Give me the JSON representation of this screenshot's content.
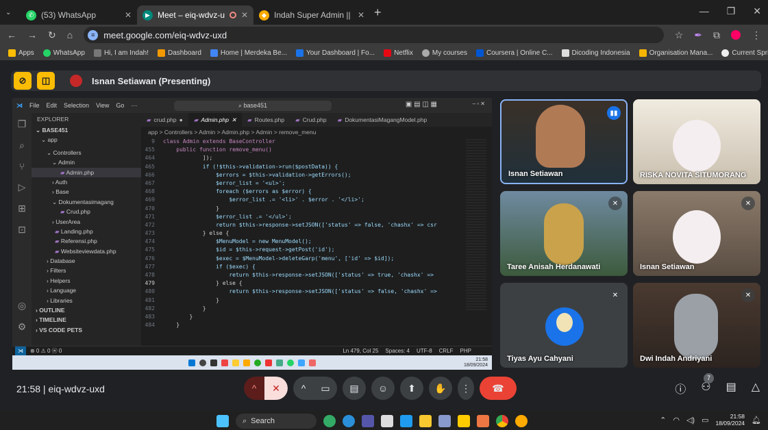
{
  "browser": {
    "tabs": [
      {
        "title": "(53) WhatsApp"
      },
      {
        "title": "Meet – eiq-wdvz-uxd"
      },
      {
        "title": "Indah Super Admin || Base 4"
      }
    ],
    "url": "meet.google.com/eiq-wdvz-uxd",
    "bookmarks": [
      "Apps",
      "WhatsApp",
      "Hi, I am Indah!",
      "Dashboard",
      "Home | Merdeka Be...",
      "Your Dashboard | Fo...",
      "Netflix",
      "My courses",
      "Coursera | Online C...",
      "Dicoding Indonesia",
      "Organisation Mana...",
      "Current Sprint - UK..."
    ],
    "more_bookmarks": "»"
  },
  "meet": {
    "presenter_label": "Isnan Setiawan (Presenting)",
    "meeting_time": "21:58",
    "meeting_code": "eiq-wdvz-uxd",
    "participant_count": "7",
    "participants": [
      {
        "name": "Isnan Setiawan"
      },
      {
        "name": "RISKA NOVITA SITUMORANG"
      },
      {
        "name": "Taree Anisah Herdanawati"
      },
      {
        "name": "Isnan Setiawan"
      },
      {
        "name": "Tiyas Ayu Cahyani"
      },
      {
        "name": "Dwi Indah Andriyani"
      }
    ]
  },
  "vscode": {
    "menu": [
      "File",
      "Edit",
      "Selection",
      "View",
      "Go",
      "···"
    ],
    "search": "base451",
    "explorer_title": "EXPLORER",
    "tree": [
      "BASE451",
      "app",
      "Controllers",
      "Admin",
      "Admin.php",
      "Auth",
      "Base",
      "Dokumentasimagang",
      "Crud.php",
      "UserArea",
      "Landing.php",
      "Referensi.php",
      "Websiteviewdata.php",
      "Database",
      "Filters",
      "Helpers",
      "Language",
      "Libraries",
      "OUTLINE",
      "TIMELINE",
      "VS CODE PETS"
    ],
    "tabs": [
      "crud.php",
      "Admin.php",
      "Routes.php",
      "Crud.php",
      "DokumentasiMagangModel.php"
    ],
    "breadcrumb": "app > Controllers > Admin > Admin.php > Admin > remove_menu",
    "code": [
      {
        "n": "9",
        "t": "class Admin extends BaseController"
      },
      {
        "n": "455",
        "t": "    public function remove_menu()"
      },
      {
        "n": "464",
        "t": "            ]);"
      },
      {
        "n": "465",
        "t": "            if (!$this->validation->run($postData)) {"
      },
      {
        "n": "466",
        "t": "                $errors = $this->validation->getErrors();"
      },
      {
        "n": "467",
        "t": "                $error_list = '<ul>';"
      },
      {
        "n": "468",
        "t": "                foreach ($errors as $error) {"
      },
      {
        "n": "469",
        "t": "                    $error_list .= '<li>' . $error . '</li>';"
      },
      {
        "n": "470",
        "t": "                }"
      },
      {
        "n": "471",
        "t": "                $error_list .= '</ul>';"
      },
      {
        "n": "472",
        "t": "                return $this->response->setJSON(['status' => false, 'chashx' => csr"
      },
      {
        "n": "473",
        "t": "            } else {"
      },
      {
        "n": "474",
        "t": "                $MenuModel = new MenuModel();"
      },
      {
        "n": "475",
        "t": "                $id = $this->request->getPost('id');"
      },
      {
        "n": "476",
        "t": "                $exec = $MenuModel->deleteGarp('menu', ['id' => $id]);"
      },
      {
        "n": "477",
        "t": "                if ($exec) {"
      },
      {
        "n": "478",
        "t": "                    return $this->response->setJSON(['status' => true, 'chashx' =>"
      },
      {
        "n": "479",
        "t": "                } else {"
      },
      {
        "n": "480",
        "t": "                    return $this->response->setJSON(['status' => false, 'chashx' =>"
      },
      {
        "n": "481",
        "t": "                }"
      },
      {
        "n": "482",
        "t": "            }"
      },
      {
        "n": "483",
        "t": "        }"
      },
      {
        "n": "484",
        "t": "    }"
      }
    ],
    "status": {
      "left": "⊗ 0 ⚠ 0   ⓦ 0",
      "items": [
        "Ln 479, Col 25",
        "Spaces: 4",
        "UTF-8",
        "CRLF",
        "PHP"
      ]
    },
    "inner_clock": {
      "time": "21:58",
      "date": "18/09/2024"
    }
  },
  "taskbar": {
    "search": "Search",
    "time": "21:58",
    "date": "18/09/2024"
  }
}
